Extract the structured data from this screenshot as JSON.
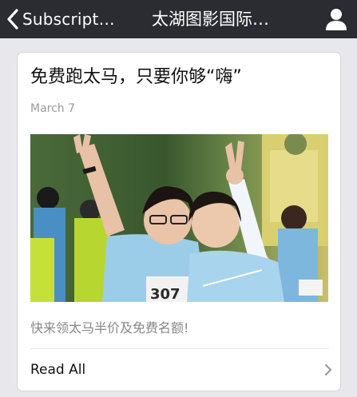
{
  "navbar": {
    "back_label": "Subscript…",
    "title": "太湖图影国际…",
    "back_icon": "chevron-left-icon",
    "profile_icon": "person-icon"
  },
  "article": {
    "title": "免费跑太马，只要你够“嗨”",
    "date": "March 7",
    "image_alt": "两名身穿浅蓝色T恤的马拉松跑者比出V字手势",
    "summary": "快来领太马半价及免费名额!",
    "read_all_label": "Read All",
    "read_all_icon": "chevron-right-icon"
  },
  "colors": {
    "navbar_bg": "#2b2c31",
    "page_bg": "#e8e8ec",
    "card_bg": "#ffffff",
    "date_text": "#9a9a9a",
    "summary_text": "#888888"
  }
}
